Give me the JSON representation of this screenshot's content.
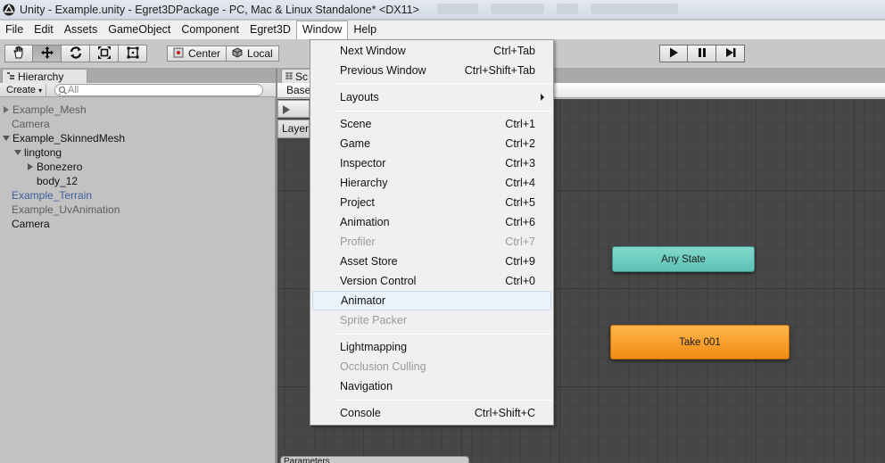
{
  "window": {
    "title": "Unity - Example.unity - Egret3DPackage - PC, Mac & Linux Standalone* <DX11>"
  },
  "menubar": {
    "items": [
      "File",
      "Edit",
      "Assets",
      "GameObject",
      "Component",
      "Egret3D",
      "Window",
      "Help"
    ],
    "active": "Window"
  },
  "toolbar": {
    "pivot_label": "Center",
    "space_label": "Local",
    "transform_tools": [
      "hand-icon",
      "move-icon",
      "rotate-icon",
      "scale-icon",
      "rect-icon"
    ],
    "playback": [
      "play-icon",
      "pause-icon",
      "step-icon"
    ]
  },
  "hierarchy": {
    "tab_label": "Hierarchy",
    "create_label": "Create",
    "search_placeholder": "All",
    "items": [
      {
        "label": "Example_Mesh",
        "depth": 0,
        "arrow": "collapsed",
        "color": "gray"
      },
      {
        "label": "Camera",
        "depth": 0,
        "arrow": "none",
        "color": "gray"
      },
      {
        "label": "Example_SkinnedMesh",
        "depth": 0,
        "arrow": "expanded",
        "color": "dark"
      },
      {
        "label": "lingtong",
        "depth": 1,
        "arrow": "expanded",
        "color": "dark"
      },
      {
        "label": "Bonezero",
        "depth": 2,
        "arrow": "collapsed",
        "color": "dark"
      },
      {
        "label": "body_12",
        "depth": 2,
        "arrow": "none",
        "color": "dark"
      },
      {
        "label": "Example_Terrain",
        "depth": 0,
        "arrow": "none",
        "color": "blue"
      },
      {
        "label": "Example_UvAnimation",
        "depth": 0,
        "arrow": "none",
        "color": "gray"
      },
      {
        "label": "Camera",
        "depth": 0,
        "arrow": "none",
        "color": "dark"
      }
    ]
  },
  "scene": {
    "tab_label": "Sc",
    "base_label": "Base",
    "layers_label": "Layer",
    "params_label": "Parameters"
  },
  "animator": {
    "states": {
      "any_state": "Any State",
      "take": "Take 001"
    }
  },
  "window_menu": {
    "items": [
      {
        "label": "Next Window",
        "shortcut": "Ctrl+Tab"
      },
      {
        "label": "Previous Window",
        "shortcut": "Ctrl+Shift+Tab"
      },
      {
        "label": "Layouts",
        "shortcut": ""
      },
      {
        "label": "Scene",
        "shortcut": "Ctrl+1"
      },
      {
        "label": "Game",
        "shortcut": "Ctrl+2"
      },
      {
        "label": "Inspector",
        "shortcut": "Ctrl+3"
      },
      {
        "label": "Hierarchy",
        "shortcut": "Ctrl+4"
      },
      {
        "label": "Project",
        "shortcut": "Ctrl+5"
      },
      {
        "label": "Animation",
        "shortcut": "Ctrl+6"
      },
      {
        "label": "Profiler",
        "shortcut": "Ctrl+7"
      },
      {
        "label": "Asset Store",
        "shortcut": "Ctrl+9"
      },
      {
        "label": "Version Control",
        "shortcut": "Ctrl+0"
      },
      {
        "label": "Animator",
        "shortcut": ""
      },
      {
        "label": "Sprite Packer",
        "shortcut": ""
      },
      {
        "label": "Lightmapping",
        "shortcut": ""
      },
      {
        "label": "Occlusion Culling",
        "shortcut": ""
      },
      {
        "label": "Navigation",
        "shortcut": ""
      },
      {
        "label": "Console",
        "shortcut": "Ctrl+Shift+C"
      }
    ],
    "disabled": [
      "Profiler",
      "Sprite Packer",
      "Occlusion Culling"
    ],
    "highlighted": "Animator",
    "submenu": "Layouts"
  },
  "colors": {
    "any_state": "#6dcdbf",
    "take_state": "#f7a030",
    "grid_bg": "#474747",
    "menu_hover": "#eaf2fb"
  }
}
